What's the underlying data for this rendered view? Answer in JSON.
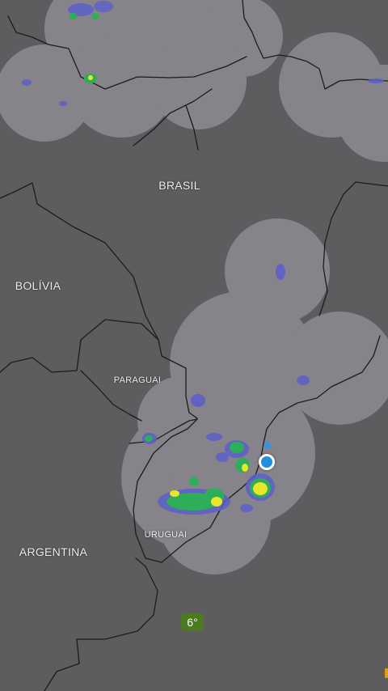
{
  "map": {
    "labels": {
      "brasil": "BRASIL",
      "bolivia": "BOLÍVIA",
      "paraguai": "PARAGUAI",
      "uruguai": "URUGUAI",
      "argentina": "ARGENTINA"
    },
    "temperature": "6°",
    "colors": {
      "background": "#5d5c5f",
      "radar_coverage": "#8e8b92",
      "border_line": "#1c1c1c",
      "rain_light": "#5c5fc9",
      "rain_moderate": "#2fae5a",
      "rain_heavy": "#e8e62a",
      "temperature_badge": "#4c7a1f",
      "location_marker": "#1f8de0"
    },
    "icons": {
      "location": "location-dot-icon",
      "heading": "heading-arrow-icon"
    }
  }
}
